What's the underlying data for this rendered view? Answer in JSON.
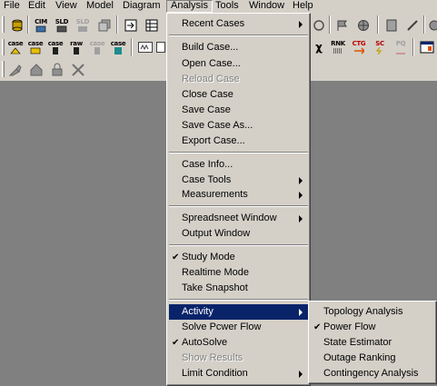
{
  "menubar": [
    "File",
    "Edit",
    "View",
    "Model",
    "Diagram",
    "Analysis",
    "Tools",
    "Window",
    "Help"
  ],
  "toolbar2": {
    "labels": [
      "case",
      "case",
      "case",
      "raw",
      "case",
      "case",
      "RNK",
      "CTG",
      "SC",
      "PQ"
    ]
  },
  "toolbar1": {
    "labels": [
      "CIM",
      "SLD",
      "SLD"
    ]
  },
  "analysis_menu": {
    "recent_cases": "Recent Cases",
    "build_case": "Build Case...",
    "open_case": "Open Case...",
    "reload_case": "Reload Case",
    "close_case": "Close Case",
    "save_case": "Save Case",
    "save_case_as": "Save Case As...",
    "export_case": "Export Case...",
    "case_info": "Case Info...",
    "case_tools": "Case Tools",
    "measurements": "Measurements",
    "spreadsheet_window": "Spreadsneet Window",
    "output_window": "Output Window",
    "study_mode": "Study Mode",
    "realtime_mode": "Realtime Mode",
    "take_snapshot": "Take Snapshot",
    "activity": "Activity",
    "solve_power_flow": "Solve Pcwer Flow",
    "autosolve": "AutoSolve",
    "show_results": "Show Results",
    "limit_condition": "Limit Condition"
  },
  "activity_submenu": {
    "topology_analysis": "Topology Analysis",
    "power_flow": "Power Flow",
    "state_estimator": "State Estimator",
    "outage_ranking": "Outage Ranking",
    "contingency_analysis": "Contingency Analysis"
  },
  "colors": {
    "highlight": "#0a246a",
    "face": "#d4d0c8",
    "workspace": "#808080"
  }
}
